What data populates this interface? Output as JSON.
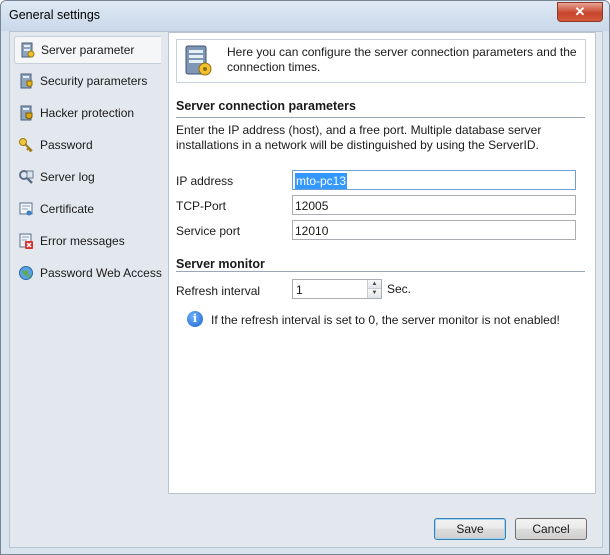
{
  "window": {
    "title": "General settings"
  },
  "sidebar": {
    "items": [
      {
        "label": "Server parameter",
        "icon": "server-icon",
        "selected": true
      },
      {
        "label": "Security parameters",
        "icon": "security-icon"
      },
      {
        "label": "Hacker protection",
        "icon": "hacker-protection-icon"
      },
      {
        "label": "Password",
        "icon": "key-icon"
      },
      {
        "label": "Server log",
        "icon": "server-log-icon"
      },
      {
        "label": "Certificate",
        "icon": "certificate-icon"
      },
      {
        "label": "Error messages",
        "icon": "error-messages-icon"
      },
      {
        "label": "Password Web Access",
        "icon": "globe-icon"
      }
    ]
  },
  "main": {
    "header_text": "Here you can configure the server connection parameters and the connection times.",
    "connection": {
      "title": "Server connection parameters",
      "description": "Enter the IP address (host), and a free port. Multiple database server installations in a network will be distinguished by using the ServerID.",
      "ip_label": "IP address",
      "ip_value": "mto-pc13",
      "tcp_label": "TCP-Port",
      "tcp_value": "12005",
      "service_label": "Service port",
      "service_value": "12010"
    },
    "monitor": {
      "title": "Server monitor",
      "refresh_label": "Refresh interval",
      "refresh_value": "1",
      "refresh_unit": "Sec.",
      "info_text": "If the refresh interval is set to 0, the server monitor is not enabled!"
    }
  },
  "buttons": {
    "save": "Save",
    "cancel": "Cancel"
  },
  "colors": {
    "accent": "#3399ff",
    "panel": "#e3e8ee",
    "close": "#c7452d"
  }
}
